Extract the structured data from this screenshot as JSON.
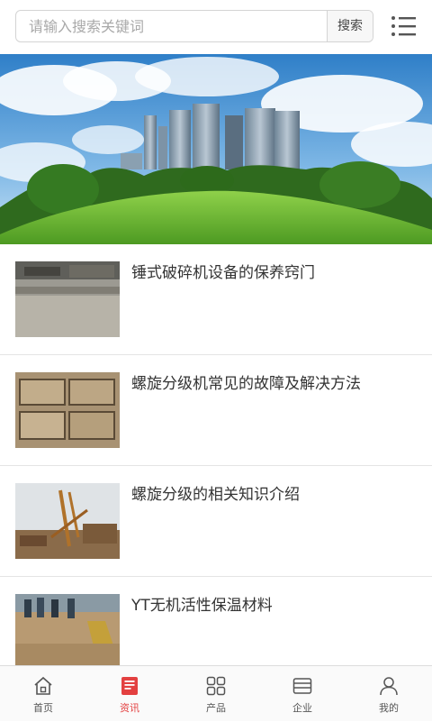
{
  "search": {
    "placeholder": "请输入搜索关键词",
    "button_label": "搜索"
  },
  "banner": {
    "slide_count": 3,
    "active_slide": 1
  },
  "news": [
    {
      "title": "锤式破碎机设备的保养窍门"
    },
    {
      "title": "螺旋分级机常见的故障及解决方法"
    },
    {
      "title": "螺旋分级的相关知识介绍"
    },
    {
      "title": "YT无机活性保温材料"
    }
  ],
  "tabs": [
    {
      "label": "首页",
      "icon": "home-icon"
    },
    {
      "label": "资讯",
      "icon": "news-icon",
      "active": true
    },
    {
      "label": "产品",
      "icon": "grid-icon"
    },
    {
      "label": "企业",
      "icon": "company-icon"
    },
    {
      "label": "我的",
      "icon": "user-icon"
    }
  ],
  "colors": {
    "accent": "#e34040",
    "text": "#333333",
    "border": "#d4d4d4"
  }
}
